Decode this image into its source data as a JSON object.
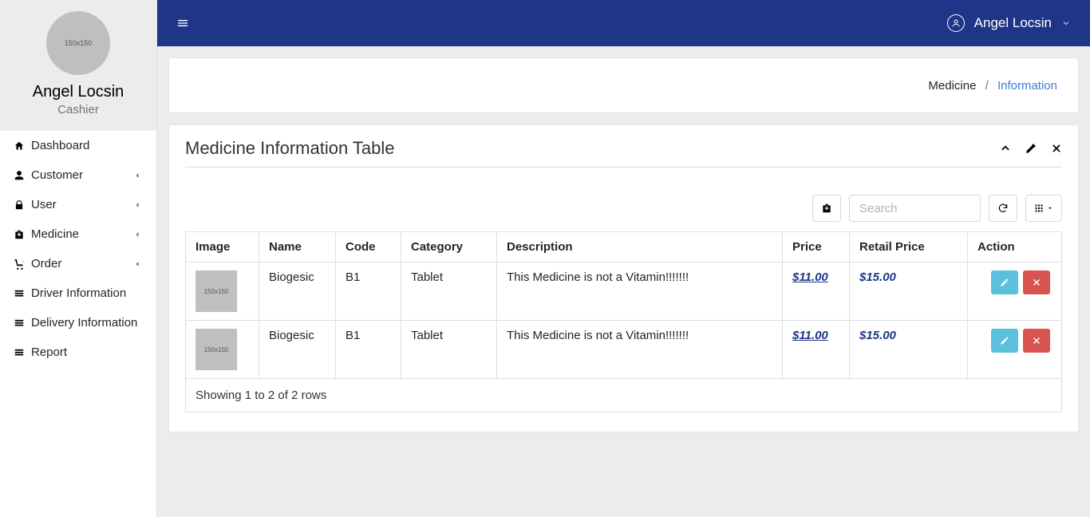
{
  "user": {
    "name": "Angel Locsin",
    "role": "Cashier",
    "avatar_placeholder": "150x150"
  },
  "topbar": {
    "user_name": "Angel Locsin"
  },
  "sidebar": {
    "items": [
      {
        "label": "Dashboard",
        "expandable": false
      },
      {
        "label": "Customer",
        "expandable": true
      },
      {
        "label": "User",
        "expandable": true
      },
      {
        "label": "Medicine",
        "expandable": true
      },
      {
        "label": "Order",
        "expandable": true
      },
      {
        "label": "Driver Information",
        "expandable": false
      },
      {
        "label": "Delivery Information",
        "expandable": false
      },
      {
        "label": "Report",
        "expandable": false
      }
    ]
  },
  "breadcrumb": {
    "parent": "Medicine",
    "current": "Information"
  },
  "panel": {
    "title": "Medicine Information Table"
  },
  "toolbar": {
    "search_placeholder": "Search"
  },
  "table": {
    "columns": {
      "image": "Image",
      "name": "Name",
      "code": "Code",
      "category": "Category",
      "description": "Description",
      "price": "Price",
      "retail_price": "Retail Price",
      "action": "Action"
    },
    "image_placeholder": "150x150",
    "rows": [
      {
        "name": "Biogesic",
        "code": "B1",
        "category": "Tablet",
        "description": "This Medicine is not a Vitamin!!!!!!!",
        "price": "$11.00",
        "retail_price": "$15.00"
      },
      {
        "name": "Biogesic",
        "code": "B1",
        "category": "Tablet",
        "description": "This Medicine is not a Vitamin!!!!!!!",
        "price": "$11.00",
        "retail_price": "$15.00"
      }
    ],
    "footer": "Showing 1 to 2 of 2 rows"
  }
}
